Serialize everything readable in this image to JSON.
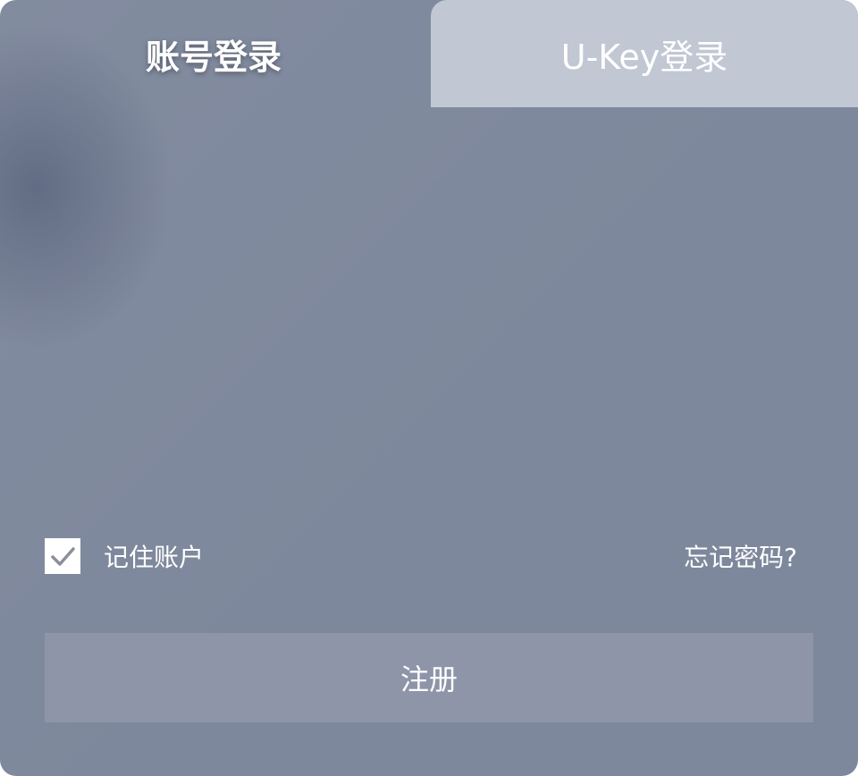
{
  "tabs": {
    "account_label": "账号登录",
    "ukey_label": "U-Key登录"
  },
  "remember": {
    "label": "记住账户",
    "checked": true
  },
  "forgot_label": "忘记密码?",
  "register_label": "注册",
  "colors": {
    "panel": "#7e889c",
    "inactive_tab": "#c1c7d3",
    "button": "#8e95a8",
    "text": "#ffffff",
    "checkmark": "#8a8f99"
  }
}
